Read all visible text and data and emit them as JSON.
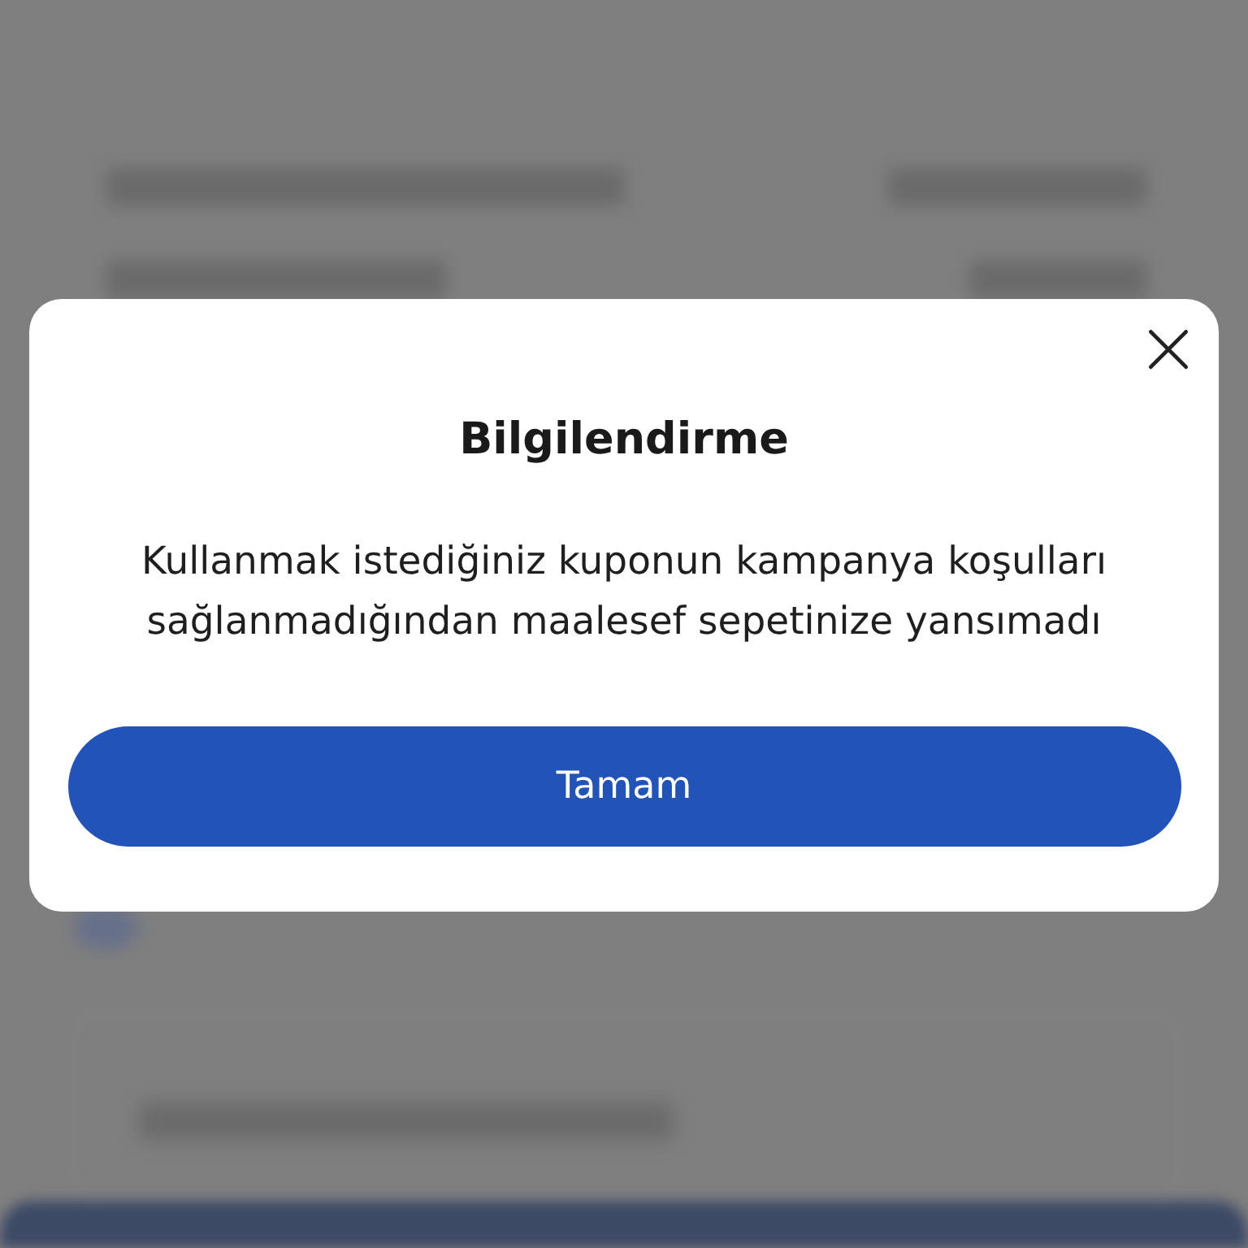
{
  "dialog": {
    "title": "Bilgilendirme",
    "message": "Kullanmak istediğiniz kuponun kampanya koşulları sağlanmadığından maalesef sepetinize yansımadı",
    "button": "Tamam"
  }
}
